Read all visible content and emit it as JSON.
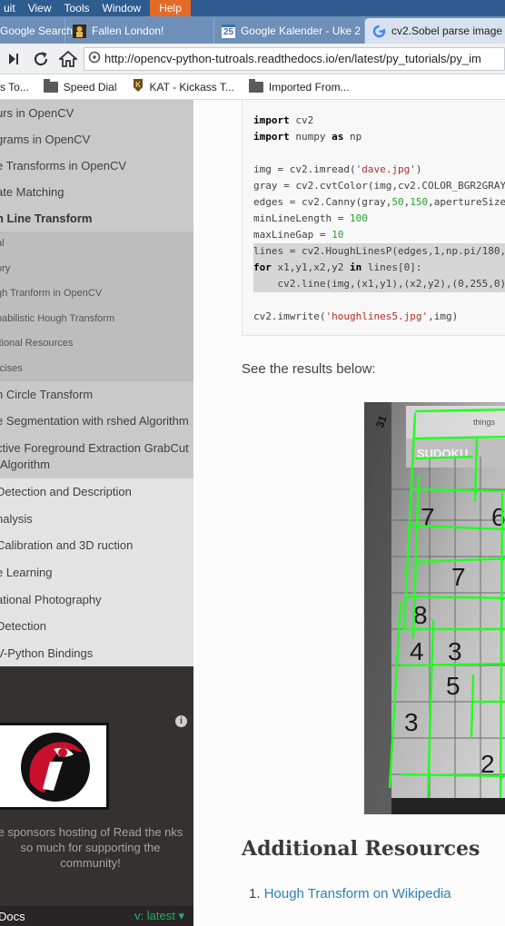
{
  "browser": {
    "menu": [
      "uit",
      "View",
      "Tools",
      "Window",
      "Help"
    ],
    "tabs": [
      {
        "label": "Google Search",
        "icon": "google-icon"
      },
      {
        "label": "Fallen London!",
        "icon": "fallen-london-icon"
      },
      {
        "label": "Google Kalender - Uke 2",
        "icon": "calendar-icon",
        "icon_text": "25"
      },
      {
        "label": "cv2.Sobel parse image",
        "icon": "google-icon"
      }
    ],
    "url": "http://opencv-python-tutroals.readthedocs.io/en/latest/py_tutorials/py_im",
    "bookmarks": [
      {
        "label": "s To...",
        "icon": "folder-icon"
      },
      {
        "label": "Speed Dial",
        "icon": "folder-icon"
      },
      {
        "label": "KAT - Kickass T...",
        "icon": "kat-icon"
      },
      {
        "label": "Imported From...",
        "icon": "folder-icon"
      }
    ]
  },
  "sidebar": {
    "items": [
      {
        "label": "urs in OpenCV",
        "level": "l3"
      },
      {
        "label": "grams in OpenCV",
        "level": "l3"
      },
      {
        "label": "e Transforms in OpenCV",
        "level": "l3"
      },
      {
        "label": "ate Matching",
        "level": "l3"
      },
      {
        "label": "h Line Transform",
        "level": "l3-current"
      },
      {
        "label": "al",
        "level": "l4"
      },
      {
        "label": "ory",
        "level": "l4"
      },
      {
        "label": "gh Tranform in OpenCV",
        "level": "l4"
      },
      {
        "label": "babilistic Hough Transform",
        "level": "l4"
      },
      {
        "label": "itional Resources",
        "level": "l4"
      },
      {
        "label": "rcises",
        "level": "l4"
      },
      {
        "label": "n Circle Transform",
        "level": "l3"
      },
      {
        "label": "e Segmentation with rshed Algorithm",
        "level": "l3 two"
      },
      {
        "label": "ctive Foreground Extraction GrabCut Algorithm",
        "level": "l3 two"
      },
      {
        "label": "Detection and Description",
        "level": "l2"
      },
      {
        "label": "nalysis",
        "level": "l2"
      },
      {
        "label": "Calibration and 3D ruction",
        "level": "l2 two"
      },
      {
        "label": "e Learning",
        "level": "l2"
      },
      {
        "label": "ational Photography",
        "level": "l2"
      },
      {
        "label": "Detection",
        "level": "l2"
      },
      {
        "label": "V-Python Bindings",
        "level": "l2"
      }
    ],
    "sponsor_text": "e sponsors hosting of Read the nks so much for supporting the community!",
    "rtd_name": "Docs",
    "rtd_version": "v: latest ▾"
  },
  "content": {
    "code_lines": [
      [
        {
          "t": "import",
          "c": "kw"
        },
        {
          "t": " cv2",
          "c": ""
        }
      ],
      [
        {
          "t": "import",
          "c": "kw"
        },
        {
          "t": " numpy ",
          "c": ""
        },
        {
          "t": "as",
          "c": "kw"
        },
        {
          "t": " np",
          "c": ""
        }
      ],
      [],
      [
        {
          "t": "img = cv2.imread(",
          "c": ""
        },
        {
          "t": "'dave.jpg'",
          "c": "str"
        },
        {
          "t": ")",
          "c": ""
        }
      ],
      [
        {
          "t": "gray = cv2.cvtColor(img,cv2.COLOR_BGR2GRAY",
          "c": ""
        }
      ],
      [
        {
          "t": "edges = cv2.Canny(gray,",
          "c": ""
        },
        {
          "t": "50",
          "c": "num"
        },
        {
          "t": ",",
          "c": ""
        },
        {
          "t": "150",
          "c": "num"
        },
        {
          "t": ",apertureSize",
          "c": ""
        }
      ],
      [
        {
          "t": "minLineLength = ",
          "c": ""
        },
        {
          "t": "100",
          "c": "num"
        }
      ],
      [
        {
          "t": "maxLineGap = ",
          "c": ""
        },
        {
          "t": "10",
          "c": "num"
        }
      ],
      [
        {
          "t": "lines = cv2.HoughLinesP(edges,1,np.pi/180,",
          "c": "hl"
        }
      ],
      [
        {
          "t": "for",
          "c": "kw hl"
        },
        {
          "t": " x1,y1,x2,y2 ",
          "c": "hl"
        },
        {
          "t": "in",
          "c": "kw hl"
        },
        {
          "t": " lines[0]:",
          "c": "hl"
        }
      ],
      [
        {
          "t": "    cv2.line(img,(x1,y1),(x2,y2),(0,255,0)",
          "c": "hl"
        }
      ],
      [],
      [
        {
          "t": "cv2.imwrite(",
          "c": ""
        },
        {
          "t": "'houghlines5.jpg'",
          "c": "str"
        },
        {
          "t": ",img)",
          "c": ""
        }
      ]
    ],
    "results_text": "See the results below:",
    "sudoku_label": "SUDOKU",
    "things_label": "things",
    "corner_label": "31",
    "digits": [
      "7",
      "6",
      "7",
      "8",
      "4",
      "3",
      "5",
      "3",
      "2"
    ],
    "section_heading": "Additional Resources",
    "references": [
      {
        "num": "1.",
        "label": "Hough Transform on Wikipedia"
      }
    ]
  }
}
